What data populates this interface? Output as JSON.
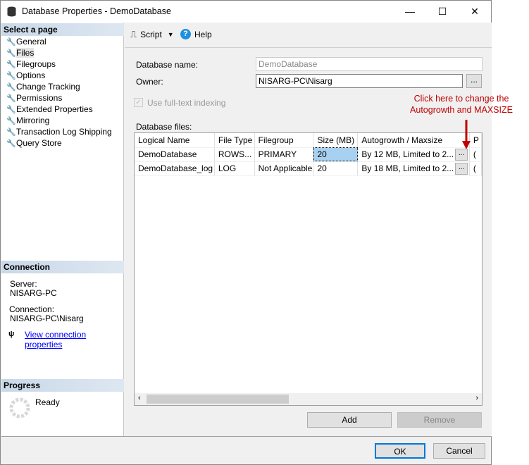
{
  "window": {
    "title": "Database Properties - DemoDatabase",
    "minimize": "—",
    "maximize": "☐",
    "close": "✕"
  },
  "sidebar": {
    "header": "Select a page",
    "items": [
      {
        "label": "General"
      },
      {
        "label": "Files",
        "selected": true
      },
      {
        "label": "Filegroups"
      },
      {
        "label": "Options"
      },
      {
        "label": "Change Tracking"
      },
      {
        "label": "Permissions"
      },
      {
        "label": "Extended Properties"
      },
      {
        "label": "Mirroring"
      },
      {
        "label": "Transaction Log Shipping"
      },
      {
        "label": "Query Store"
      }
    ]
  },
  "connection": {
    "header": "Connection",
    "server_label": "Server:",
    "server": "NISARG-PC",
    "connection_label": "Connection:",
    "connection": "NISARG-PC\\Nisarg",
    "link": "View connection properties"
  },
  "progress": {
    "header": "Progress",
    "status": "Ready"
  },
  "toolbar": {
    "script": "Script",
    "help": "Help"
  },
  "form": {
    "dbname_label": "Database name:",
    "dbname": "DemoDatabase",
    "owner_label": "Owner:",
    "owner": "NISARG-PC\\Nisarg",
    "browse": "...",
    "fulltext_label": "Use full-text indexing",
    "fulltext_checked": true,
    "files_label": "Database files:"
  },
  "annotation": {
    "line1": "Click here to change the",
    "line2": "Autogrowth and MAXSIZE",
    "color": "#c00000"
  },
  "grid": {
    "columns": [
      "Logical Name",
      "File Type",
      "Filegroup",
      "Size (MB)",
      "Autogrowth / Maxsize",
      "",
      "P"
    ],
    "rows": [
      [
        "DemoDatabase",
        "ROWS...",
        "PRIMARY",
        "20",
        "By 12 MB, Limited to 2...",
        "...",
        "("
      ],
      [
        "DemoDatabase_log",
        "LOG",
        "Not Applicable",
        "20",
        "By 18 MB, Limited to 2...",
        "...",
        "("
      ]
    ]
  },
  "buttons": {
    "add": "Add",
    "remove": "Remove",
    "ok": "OK",
    "cancel": "Cancel"
  }
}
